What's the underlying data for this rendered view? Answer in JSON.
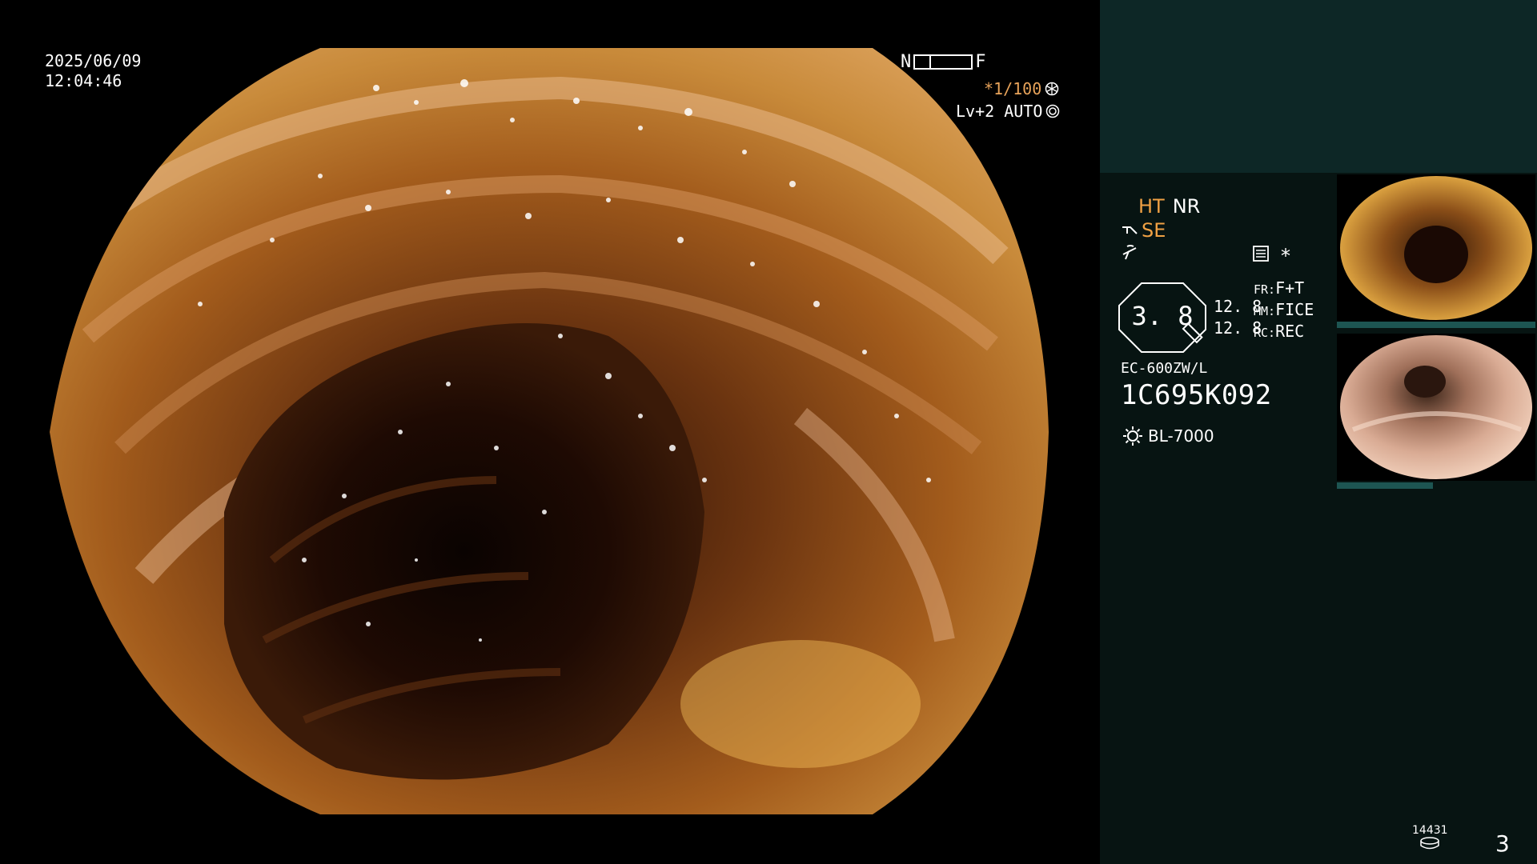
{
  "overlay": {
    "date": "2025/06/09",
    "time": "12:04:46",
    "near_label": "N",
    "far_label": "F",
    "shutter": "*1/100",
    "level": "Lv+2 AUTO"
  },
  "side_panel": {
    "mode_ht": "HT",
    "mode_nr": "NR",
    "mode_se": "SE",
    "asterisk": "*",
    "zoom_value": "3. 8",
    "num_top": "12. 8",
    "num_bottom": "12. 8",
    "fr_key": "FR:",
    "fr_value": "F+T",
    "mm_key": "MM:",
    "mm_value": "FICE",
    "rc_key": "RC:",
    "rc_value": "REC",
    "scope_model": "EC-600ZW/L",
    "scope_serial": "1C695K092",
    "light_source": "BL-7000",
    "storage_count": "14431",
    "page_number": "3"
  },
  "colors": {
    "accent_orange": "#f0a144",
    "panel_bg": "#071412",
    "panel_top": "#0d2726",
    "thumb_bar": "#1d5552"
  }
}
